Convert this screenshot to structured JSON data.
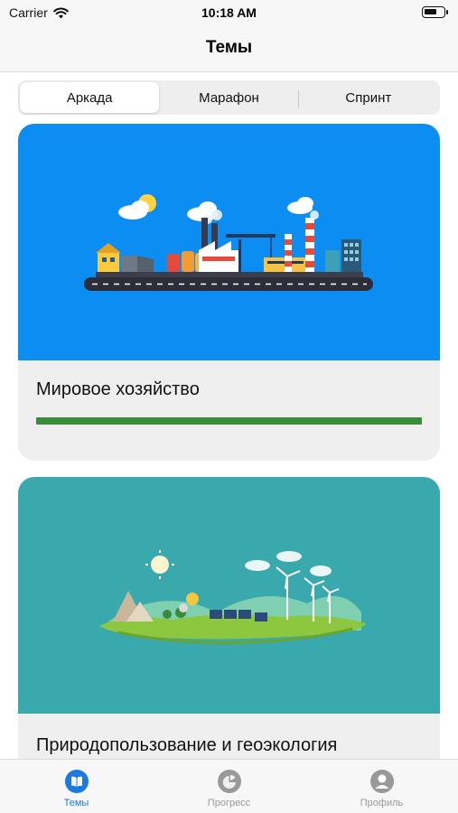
{
  "status_bar": {
    "carrier": "Carrier",
    "time": "10:18 AM"
  },
  "header": {
    "title": "Темы"
  },
  "segmented_control": {
    "segments": [
      {
        "label": "Аркада",
        "selected": true
      },
      {
        "label": "Марафон",
        "selected": false
      },
      {
        "label": "Спринт",
        "selected": false
      }
    ]
  },
  "topics": [
    {
      "title": "Мировое хозяйство",
      "illustration": "industrial-city-illustration",
      "image_background": "#0b8df1",
      "progress": 1.0,
      "progress_color": "#3c8c3c"
    },
    {
      "title": "Природопользование и геоэкология",
      "illustration": "green-energy-landscape-illustration",
      "image_background": "#39a9ad"
    }
  ],
  "tab_bar": {
    "items": [
      {
        "label": "Темы",
        "icon": "book-icon",
        "active": true
      },
      {
        "label": "Прогресс",
        "icon": "pie-chart-icon",
        "active": false
      },
      {
        "label": "Профиль",
        "icon": "profile-icon",
        "active": false
      }
    ],
    "active_color": "#1a7ae0",
    "inactive_color": "#999999"
  }
}
